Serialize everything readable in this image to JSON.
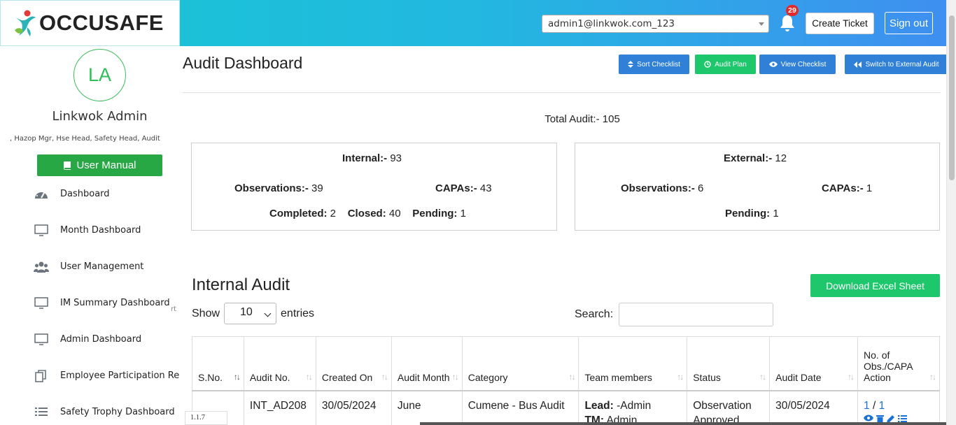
{
  "header": {
    "brand": "OCCUSAFE",
    "user_select_value": "admin1@linkwok.com_123",
    "notification_count": "29",
    "create_ticket": "Create Ticket",
    "sign_out": "Sign out",
    "colors": {
      "gradient_start": "#18c7d3",
      "gradient_end": "#3f8ff0"
    }
  },
  "sidebar": {
    "avatar_initials": "LA",
    "user_name": "Linkwok Admin",
    "roles": ", Hazop Mgr, Hse Head, Safety Head, Audit",
    "manual_button": "User Manual",
    "stray_text": "rt",
    "items": [
      {
        "label": "Dashboard",
        "icon": "gauge-icon"
      },
      {
        "label": "Month Dashboard",
        "icon": "monitor-icon"
      },
      {
        "label": "User Management",
        "icon": "users-icon"
      },
      {
        "label": "IM Summary Dashboard",
        "icon": "monitor-icon"
      },
      {
        "label": "Admin Dashboard",
        "icon": "monitor-icon"
      },
      {
        "label": "Employee Participation Re",
        "icon": "copy-icon"
      },
      {
        "label": "Safety Trophy Dashboard",
        "icon": "list-icon"
      }
    ],
    "version": "1.1.7"
  },
  "main": {
    "title": "Audit Dashboard",
    "buttons": {
      "sort_checklist": "Sort Checklist",
      "audit_plan": "Audit Plan",
      "view_checklist": "View Checklist",
      "switch_external": "Switch to External Audit"
    },
    "total_label": "Total Audit:-",
    "total_value": "105",
    "internal": {
      "label": "Internal:-",
      "value": "93",
      "obs_label": "Observations:-",
      "obs_value": "39",
      "capa_label": "CAPAs:-",
      "capa_value": "43",
      "completed_label": "Completed:",
      "completed_value": "2",
      "closed_label": "Closed:",
      "closed_value": "40",
      "pending_label": "Pending:",
      "pending_value": "1"
    },
    "external": {
      "label": "External:-",
      "value": "12",
      "obs_label": "Observations:-",
      "obs_value": "6",
      "capa_label": "CAPAs:-",
      "capa_value": "1",
      "pending_label": "Pending:",
      "pending_value": "1"
    },
    "section_title": "Internal Audit",
    "download_button": "Download Excel Sheet",
    "show_label": "Show",
    "entries_value": "10",
    "entries_label": "entries",
    "search_label": "Search:",
    "search_value": "",
    "table": {
      "headers": [
        "S.No.",
        "Audit No.",
        "Created On",
        "Audit Month",
        "Category",
        "Team members",
        "Status",
        "Audit Date",
        "No. of Obs./CAPA Action"
      ],
      "rows": [
        {
          "sno": "",
          "audit_no": "INT_AD208",
          "created_on": "30/05/2024",
          "audit_month": "June",
          "category": "Cumene - Bus Audit",
          "lead_label": "Lead:",
          "lead_value": "-Admin",
          "tm_label": "TM:",
          "tm_value": "Admin",
          "status": "Observation Approved",
          "audit_date": "30/05/2024",
          "obs": "1",
          "sep": "/",
          "capa": "1"
        }
      ]
    }
  }
}
